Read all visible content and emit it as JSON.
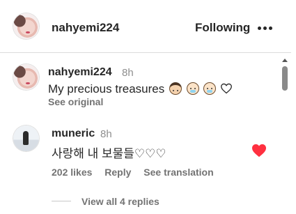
{
  "header": {
    "username": "nahyemi224",
    "follow_status": "Following",
    "more_icon": "more-horizontal-icon"
  },
  "comments": [
    {
      "username": "nahyemi224",
      "time": "8h",
      "text": "My precious treasures",
      "emojis": [
        "boy-face-emoji",
        "baby-face-emoji",
        "baby-face-emoji",
        "white-heart-emoji"
      ],
      "see_original": "See original"
    },
    {
      "username": "muneric",
      "time": "8h",
      "text": "사랑해 내 보물들♡♡♡",
      "likes": "202 likes",
      "reply": "Reply",
      "see_translation": "See translation",
      "liked": true,
      "like_color": "#ff3040",
      "view_replies": "View all 4 replies"
    }
  ]
}
